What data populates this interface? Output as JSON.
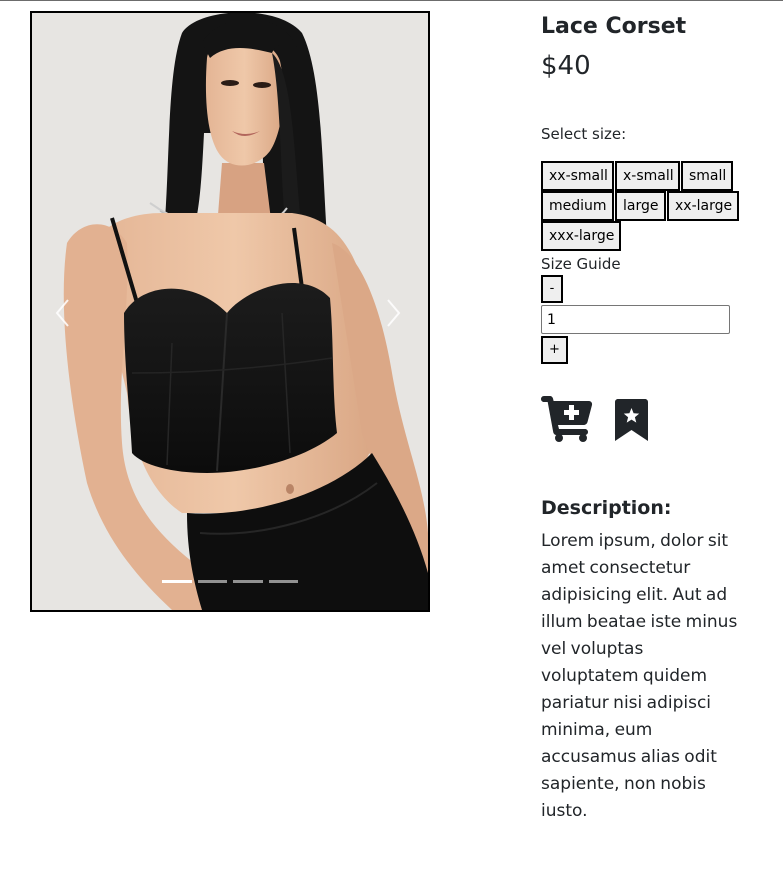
{
  "product": {
    "title": "Lace Corset",
    "price": "$40"
  },
  "carousel": {
    "image_alt": "Model wearing black lace corset top",
    "indicator_count": 4,
    "active_index": 0
  },
  "size_selector": {
    "label": "Select size:",
    "options": [
      "xx-small",
      "x-small",
      "small",
      "medium",
      "large",
      "xx-large",
      "xxx-large"
    ]
  },
  "size_guide": "Size Guide",
  "quantity": {
    "decrement_label": "-",
    "value": "1",
    "increment_label": "+"
  },
  "actions": {
    "cart_icon": "cart-plus-icon",
    "wishlist_icon": "bookmark-star-icon"
  },
  "description": {
    "heading": "Description:",
    "text": "Lorem ipsum, dolor sit amet consectetur adipisicing elit. Aut ad illum beatae iste minus vel voluptas voluptatem quidem pariatur nisi adipisci minima, eum accusamus alias odit sapiente, non nobis iusto."
  },
  "colors": {
    "text": "#212529",
    "border": "#000000",
    "button_bg": "#efefef",
    "photo_bg": "#e6e4e1"
  }
}
